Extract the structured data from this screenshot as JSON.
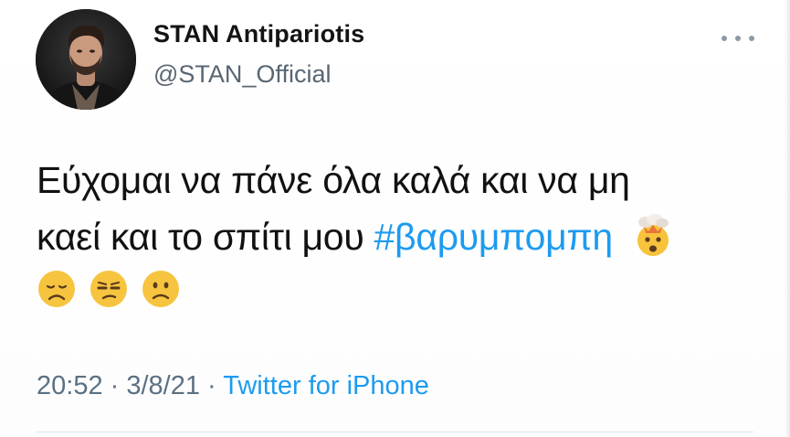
{
  "user": {
    "display_name": "STAN Antipariotis",
    "handle": "@STAN_Official",
    "avatar_icon": "profile-photo"
  },
  "more_icon": "more-dots-icon",
  "tweet": {
    "line1": "Εύχομαι να πάνε όλα καλά και να μη",
    "line2_text": "καεί και το σπίτι μου ",
    "hashtag": "#βαρυμπομπη",
    "emojis": [
      "exploding-head-emoji",
      "disappointed-face-emoji",
      "unamused-face-emoji",
      "slightly-frowning-face-emoji"
    ]
  },
  "meta": {
    "time": "20:52",
    "separator": " · ",
    "date": "3/8/21",
    "client": "Twitter for iPhone"
  },
  "colors": {
    "link": "#1d9bf0",
    "secondary": "#5b7083",
    "text": "#111111"
  }
}
